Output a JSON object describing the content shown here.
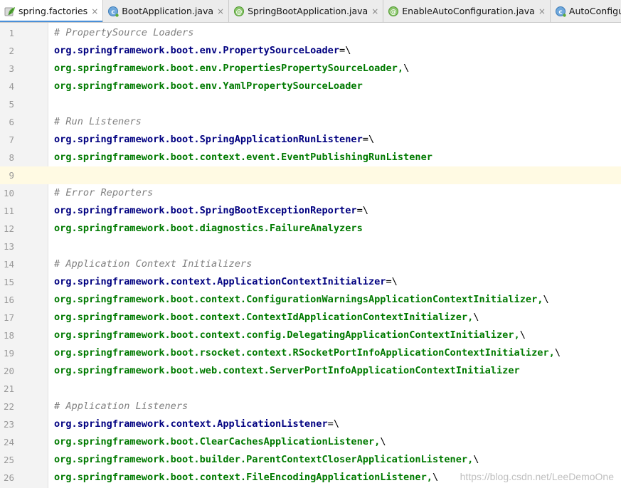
{
  "tabs": [
    {
      "label": "spring.factories",
      "icon": "spring-leaf-icon",
      "active": true
    },
    {
      "label": "BootApplication.java",
      "icon": "class-icon",
      "active": false
    },
    {
      "label": "SpringBootApplication.java",
      "icon": "annotation-icon",
      "active": false
    },
    {
      "label": "EnableAutoConfiguration.java",
      "icon": "annotation-icon",
      "active": false
    },
    {
      "label": "AutoConfigurationIm",
      "icon": "class-icon",
      "active": false
    }
  ],
  "close_glyph": "×",
  "current_line": 9,
  "lines": [
    {
      "n": "1",
      "type": "comment",
      "text": "# PropertySource Loaders"
    },
    {
      "n": "2",
      "type": "kv",
      "key": "org.springframework.boot.env.PropertySourceLoader",
      "sep": "=\\"
    },
    {
      "n": "3",
      "type": "val",
      "text": "org.springframework.boot.env.PropertiesPropertySourceLoader,",
      "tail": "\\"
    },
    {
      "n": "4",
      "type": "val",
      "text": "org.springframework.boot.env.YamlPropertySourceLoader",
      "tail": ""
    },
    {
      "n": "5",
      "type": "blank"
    },
    {
      "n": "6",
      "type": "comment",
      "text": "# Run Listeners"
    },
    {
      "n": "7",
      "type": "kv",
      "key": "org.springframework.boot.SpringApplicationRunListener",
      "sep": "=\\"
    },
    {
      "n": "8",
      "type": "val",
      "text": "org.springframework.boot.context.event.EventPublishingRunListener",
      "tail": ""
    },
    {
      "n": "9",
      "type": "blank"
    },
    {
      "n": "10",
      "type": "comment",
      "text": "# Error Reporters"
    },
    {
      "n": "11",
      "type": "kv",
      "key": "org.springframework.boot.SpringBootExceptionReporter",
      "sep": "=\\"
    },
    {
      "n": "12",
      "type": "val",
      "text": "org.springframework.boot.diagnostics.FailureAnalyzers",
      "tail": ""
    },
    {
      "n": "13",
      "type": "blank"
    },
    {
      "n": "14",
      "type": "comment",
      "text": "# Application Context Initializers"
    },
    {
      "n": "15",
      "type": "kv",
      "key": "org.springframework.context.ApplicationContextInitializer",
      "sep": "=\\"
    },
    {
      "n": "16",
      "type": "val",
      "text": "org.springframework.boot.context.ConfigurationWarningsApplicationContextInitializer,",
      "tail": "\\"
    },
    {
      "n": "17",
      "type": "val",
      "text": "org.springframework.boot.context.ContextIdApplicationContextInitializer,",
      "tail": "\\"
    },
    {
      "n": "18",
      "type": "val",
      "text": "org.springframework.boot.context.config.DelegatingApplicationContextInitializer,",
      "tail": "\\"
    },
    {
      "n": "19",
      "type": "val",
      "text": "org.springframework.boot.rsocket.context.RSocketPortInfoApplicationContextInitializer,",
      "tail": "\\"
    },
    {
      "n": "20",
      "type": "val",
      "text": "org.springframework.boot.web.context.ServerPortInfoApplicationContextInitializer",
      "tail": ""
    },
    {
      "n": "21",
      "type": "blank"
    },
    {
      "n": "22",
      "type": "comment",
      "text": "# Application Listeners"
    },
    {
      "n": "23",
      "type": "kv",
      "key": "org.springframework.context.ApplicationListener",
      "sep": "=\\"
    },
    {
      "n": "24",
      "type": "val",
      "text": "org.springframework.boot.ClearCachesApplicationListener,",
      "tail": "\\"
    },
    {
      "n": "25",
      "type": "val",
      "text": "org.springframework.boot.builder.ParentContextCloserApplicationListener,",
      "tail": "\\"
    },
    {
      "n": "26",
      "type": "val",
      "text": "org.springframework.boot.context.FileEncodingApplicationListener,",
      "tail": "\\"
    }
  ],
  "watermark": "https://blog.csdn.net/LeeDemoOne",
  "colors": {
    "key": "#000080",
    "value": "#007a00",
    "comment": "#808080",
    "current_line_bg": "#fffae3",
    "tab_accent": "#4a90d9"
  }
}
